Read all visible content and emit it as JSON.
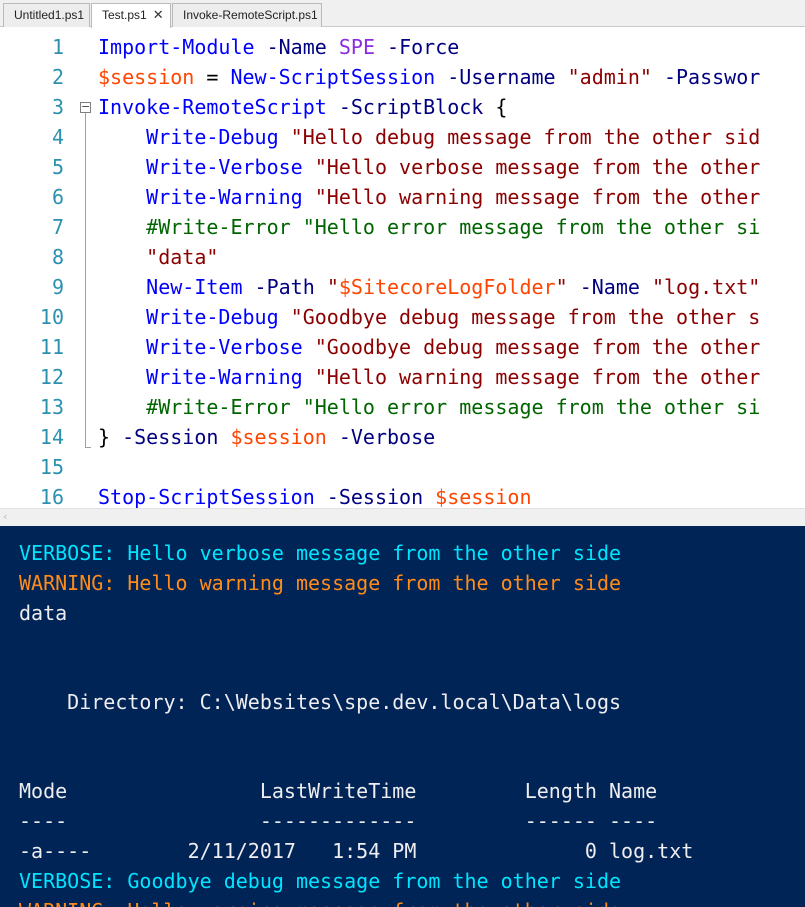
{
  "tabs": [
    {
      "label": "Untitled1.ps1",
      "active": false
    },
    {
      "label": "Test.ps1",
      "active": true,
      "close": "✕"
    },
    {
      "label": "Invoke-RemoteScript.ps1",
      "active": false
    }
  ],
  "editor": {
    "lines": [
      {
        "num": "1",
        "tokens": [
          [
            "cmd",
            "Import-Module"
          ],
          [
            "plain",
            " "
          ],
          [
            "par",
            "-Name"
          ],
          [
            "plain",
            " "
          ],
          [
            "spe",
            "SPE"
          ],
          [
            "plain",
            " "
          ],
          [
            "par",
            "-Force"
          ]
        ]
      },
      {
        "num": "2",
        "tokens": [
          [
            "var",
            "$session"
          ],
          [
            "plain",
            " = "
          ],
          [
            "cmd",
            "New-ScriptSession"
          ],
          [
            "plain",
            " "
          ],
          [
            "par",
            "-Username"
          ],
          [
            "plain",
            " "
          ],
          [
            "str",
            "\"admin\""
          ],
          [
            "plain",
            " "
          ],
          [
            "par",
            "-Passwor"
          ]
        ]
      },
      {
        "num": "3",
        "tokens": [
          [
            "cmd",
            "Invoke-RemoteScript"
          ],
          [
            "plain",
            " "
          ],
          [
            "par",
            "-ScriptBlock"
          ],
          [
            "plain",
            " {"
          ]
        ]
      },
      {
        "num": "4",
        "tokens": [
          [
            "plain",
            "    "
          ],
          [
            "cmd",
            "Write-Debug"
          ],
          [
            "plain",
            " "
          ],
          [
            "str",
            "\"Hello debug message from the other sid"
          ]
        ]
      },
      {
        "num": "5",
        "tokens": [
          [
            "plain",
            "    "
          ],
          [
            "cmd",
            "Write-Verbose"
          ],
          [
            "plain",
            " "
          ],
          [
            "str",
            "\"Hello verbose message from the other"
          ]
        ]
      },
      {
        "num": "6",
        "tokens": [
          [
            "plain",
            "    "
          ],
          [
            "cmd",
            "Write-Warning"
          ],
          [
            "plain",
            " "
          ],
          [
            "str",
            "\"Hello warning message from the other"
          ]
        ]
      },
      {
        "num": "7",
        "tokens": [
          [
            "plain",
            "    "
          ],
          [
            "com",
            "#Write-Error \"Hello error message from the other si"
          ]
        ]
      },
      {
        "num": "8",
        "tokens": [
          [
            "plain",
            "    "
          ],
          [
            "str",
            "\"data\""
          ]
        ]
      },
      {
        "num": "9",
        "tokens": [
          [
            "plain",
            "    "
          ],
          [
            "cmd",
            "New-Item"
          ],
          [
            "plain",
            " "
          ],
          [
            "par",
            "-Path"
          ],
          [
            "plain",
            " "
          ],
          [
            "str",
            "\""
          ],
          [
            "var",
            "$SitecoreLogFolder"
          ],
          [
            "str",
            "\""
          ],
          [
            "plain",
            " "
          ],
          [
            "par",
            "-Name"
          ],
          [
            "plain",
            " "
          ],
          [
            "str",
            "\"log.txt\""
          ]
        ]
      },
      {
        "num": "10",
        "tokens": [
          [
            "plain",
            "    "
          ],
          [
            "cmd",
            "Write-Debug"
          ],
          [
            "plain",
            " "
          ],
          [
            "str",
            "\"Goodbye debug message from the other s"
          ]
        ]
      },
      {
        "num": "11",
        "tokens": [
          [
            "plain",
            "    "
          ],
          [
            "cmd",
            "Write-Verbose"
          ],
          [
            "plain",
            " "
          ],
          [
            "str",
            "\"Goodbye debug message from the other"
          ]
        ]
      },
      {
        "num": "12",
        "tokens": [
          [
            "plain",
            "    "
          ],
          [
            "cmd",
            "Write-Warning"
          ],
          [
            "plain",
            " "
          ],
          [
            "str",
            "\"Hello warning message from the other"
          ]
        ]
      },
      {
        "num": "13",
        "tokens": [
          [
            "plain",
            "    "
          ],
          [
            "com",
            "#Write-Error \"Hello error message from the other si"
          ]
        ]
      },
      {
        "num": "14",
        "tokens": [
          [
            "plain",
            "} "
          ],
          [
            "par",
            "-Session"
          ],
          [
            "plain",
            " "
          ],
          [
            "var",
            "$session"
          ],
          [
            "plain",
            " "
          ],
          [
            "par",
            "-Verbose"
          ]
        ]
      },
      {
        "num": "15",
        "tokens": []
      },
      {
        "num": "16",
        "tokens": [
          [
            "cmd",
            "Stop-ScriptSession"
          ],
          [
            "plain",
            " "
          ],
          [
            "par",
            "-Session"
          ],
          [
            "plain",
            " "
          ],
          [
            "var",
            "$session"
          ]
        ]
      }
    ]
  },
  "scrollbar": {
    "left_arrow": "‹"
  },
  "console": {
    "lines": [
      {
        "kind": "verbose",
        "text": "VERBOSE: Hello verbose message from the other side"
      },
      {
        "kind": "warning",
        "text": "WARNING: Hello warning message from the other side"
      },
      {
        "kind": "out",
        "text": "data"
      },
      {
        "kind": "out",
        "text": ""
      },
      {
        "kind": "out",
        "text": ""
      },
      {
        "kind": "out",
        "text": "    Directory: C:\\Websites\\spe.dev.local\\Data\\logs"
      },
      {
        "kind": "out",
        "text": ""
      },
      {
        "kind": "out",
        "text": ""
      },
      {
        "kind": "out",
        "text": "Mode                LastWriteTime         Length Name"
      },
      {
        "kind": "out",
        "text": "----                -------------         ------ ----"
      },
      {
        "kind": "out",
        "text": "-a----        2/11/2017   1:54 PM              0 log.txt"
      },
      {
        "kind": "verbose",
        "text": "VERBOSE: Goodbye debug message from the other side"
      },
      {
        "kind": "warning",
        "text": "WARNING: Hello warning message from the other side"
      }
    ]
  },
  "colors": {
    "console_bg": "#012456",
    "verbose": "#00e5ff",
    "warning": "#ff8c1a",
    "cmdlet": "#0000ff",
    "variable": "#ff4500",
    "string": "#8b0000",
    "comment": "#006400"
  }
}
